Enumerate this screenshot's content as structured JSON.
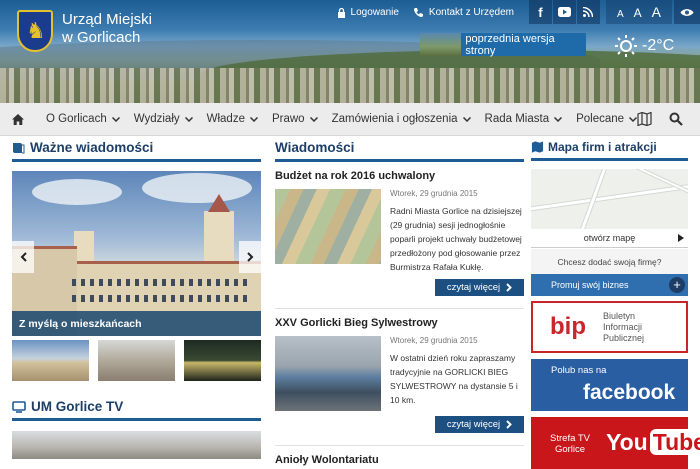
{
  "header": {
    "title_line1": "Urząd Miejski",
    "title_line2": "w Gorlicach",
    "login_label": "Logowanie",
    "contact_label": "Kontakt z Urzędem",
    "font_small": "A",
    "font_medium": "A",
    "font_large": "A",
    "old_version_label": "poprzednia wersja strony",
    "temperature": "-2°C"
  },
  "nav": {
    "items": [
      "O Gorlicach",
      "Wydziały",
      "Władze",
      "Prawo",
      "Zamówienia i ogłoszenia",
      "Rada Miasta",
      "Polecane"
    ]
  },
  "important": {
    "title": "Ważne wiadomości",
    "slide_caption": "Z myślą o mieszkańcach"
  },
  "tv": {
    "title": "UM Gorlice TV"
  },
  "news": {
    "title": "Wiadomości",
    "more_label": "czytaj więcej",
    "articles": [
      {
        "title": "Budżet na rok 2016 uchwalony",
        "date": "Wtorek, 29 grudnia 2015",
        "text": "Radni Miasta Gorlice na dzisiejszej (29 grudnia) sesji jednogłośnie poparli projekt uchwały budżetowej przedłożony pod głosowanie przez Burmistrza Rafała Kukłę."
      },
      {
        "title": "XXV Gorlicki Bieg Sylwestrowy",
        "date": "Wtorek, 29 grudnia 2015",
        "text": "W ostatni dzień roku zapraszamy tradycyjnie na GORLICKI BIEG SYLWESTROWY na dystansie 5 i 10 km."
      },
      {
        "title": "Anioły Wolontariatu"
      }
    ]
  },
  "sidebar": {
    "map_title": "Mapa firm i atrakcji",
    "open_map": "otwórz mapę",
    "add_company": "Chcesz dodać swoją firmę?",
    "promote": "Promuj swój biznes",
    "bip_logo": "bip",
    "bip_line1": "Biuletyn",
    "bip_line2": "Informacji",
    "bip_line3": "Publicznej",
    "fb_small": "Polub nas na",
    "fb_big": "facebook",
    "yt_small": "Strefa TV Gorlice",
    "yt_you": "You",
    "yt_tube": "Tube"
  },
  "colors": {
    "brand_blue": "#1c4f82",
    "nav_bg": "#ececec",
    "bip_red": "#c9262a",
    "facebook": "#2a5ea3",
    "youtube": "#c8161a"
  },
  "icons": [
    "crest-logo",
    "lock-icon",
    "phone-icon",
    "facebook-icon",
    "youtube-icon",
    "rss-icon",
    "eye-icon",
    "sun-icon",
    "home-icon",
    "map-icon",
    "search-icon",
    "book-icon",
    "tv-icon",
    "chevron-down-icon",
    "chevron-right-icon"
  ]
}
